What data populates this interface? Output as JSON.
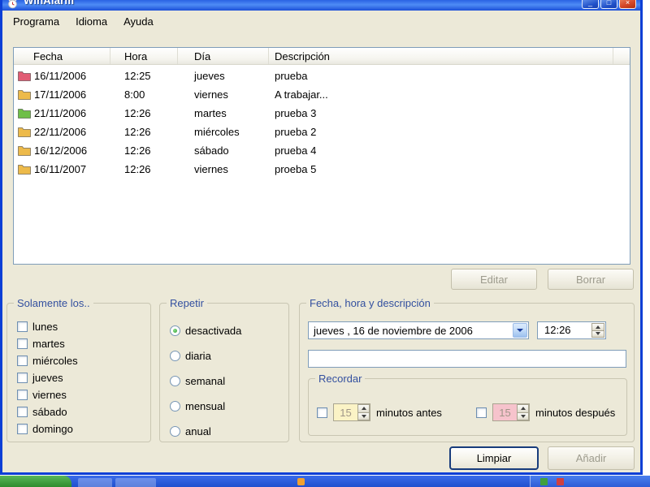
{
  "colors": {
    "titlebar_blue": "#2A63E4",
    "window_border": "#0C3FD6",
    "client_bg": "#ECE9D8",
    "group_caption": "#33509F",
    "before_spinner_bg": "#FBF3C6",
    "after_spinner_bg": "#F6C3CC",
    "taskbar_blue": "#2050CE",
    "start_green": "#2E8C2E"
  },
  "window": {
    "title": "WinAlarm",
    "controls": {
      "minimize": "_",
      "maximize": "□",
      "close": "×"
    }
  },
  "menu": {
    "items": [
      {
        "label": "Programa"
      },
      {
        "label": "Idioma"
      },
      {
        "label": "Ayuda"
      }
    ]
  },
  "alarm_list": {
    "columns": {
      "fecha": "Fecha",
      "hora": "Hora",
      "dia": "Día",
      "descripcion": "Descripción"
    },
    "rows": [
      {
        "icon": "folder-icon",
        "icon_color": "#E15C74",
        "fecha": "16/11/2006",
        "hora": "12:25",
        "dia": "jueves",
        "descripcion": "prueba"
      },
      {
        "icon": "folder-icon",
        "icon_color": "#EDBA4A",
        "fecha": "17/11/2006",
        "hora": "8:00",
        "dia": "viernes",
        "descripcion": "A trabajar..."
      },
      {
        "icon": "folder-icon",
        "icon_color": "#6FBF48",
        "fecha": "21/11/2006",
        "hora": "12:26",
        "dia": "martes",
        "descripcion": "prueba 3"
      },
      {
        "icon": "folder-icon",
        "icon_color": "#EDBA4A",
        "fecha": "22/11/2006",
        "hora": "12:26",
        "dia": "miércoles",
        "descripcion": "prueba 2"
      },
      {
        "icon": "folder-icon",
        "icon_color": "#EDBA4A",
        "fecha": "16/12/2006",
        "hora": "12:26",
        "dia": "sábado",
        "descripcion": "prueba 4"
      },
      {
        "icon": "folder-icon",
        "icon_color": "#EDBA4A",
        "fecha": "16/11/2007",
        "hora": "12:26",
        "dia": "viernes",
        "descripcion": "proeba 5"
      }
    ]
  },
  "list_actions": {
    "editar": "Editar",
    "borrar": "Borrar"
  },
  "groups": {
    "solamente": {
      "title": "Solamente los..",
      "days": [
        {
          "label": "lunes",
          "checked": false
        },
        {
          "label": "martes",
          "checked": false
        },
        {
          "label": "miércoles",
          "checked": false
        },
        {
          "label": "jueves",
          "checked": false
        },
        {
          "label": "viernes",
          "checked": false
        },
        {
          "label": "sábado",
          "checked": false
        },
        {
          "label": "domingo",
          "checked": false
        }
      ]
    },
    "repetir": {
      "title": "Repetir",
      "options": [
        {
          "label": "desactivada",
          "selected": true
        },
        {
          "label": "diaria",
          "selected": false
        },
        {
          "label": "semanal",
          "selected": false
        },
        {
          "label": "mensual",
          "selected": false
        },
        {
          "label": "anual",
          "selected": false
        }
      ]
    },
    "fecha": {
      "title": "Fecha, hora y descripción",
      "date_value": "jueves , 16 de noviembre de 2006",
      "time_value": "12:26",
      "description_value": "",
      "recordar": {
        "title": "Recordar",
        "before": {
          "value": "15",
          "label": "minutos antes",
          "checked": false
        },
        "after": {
          "value": "15",
          "label": "minutos después",
          "checked": false
        }
      }
    }
  },
  "form_actions": {
    "limpiar": "Limpiar",
    "anadir": "Añadir"
  }
}
